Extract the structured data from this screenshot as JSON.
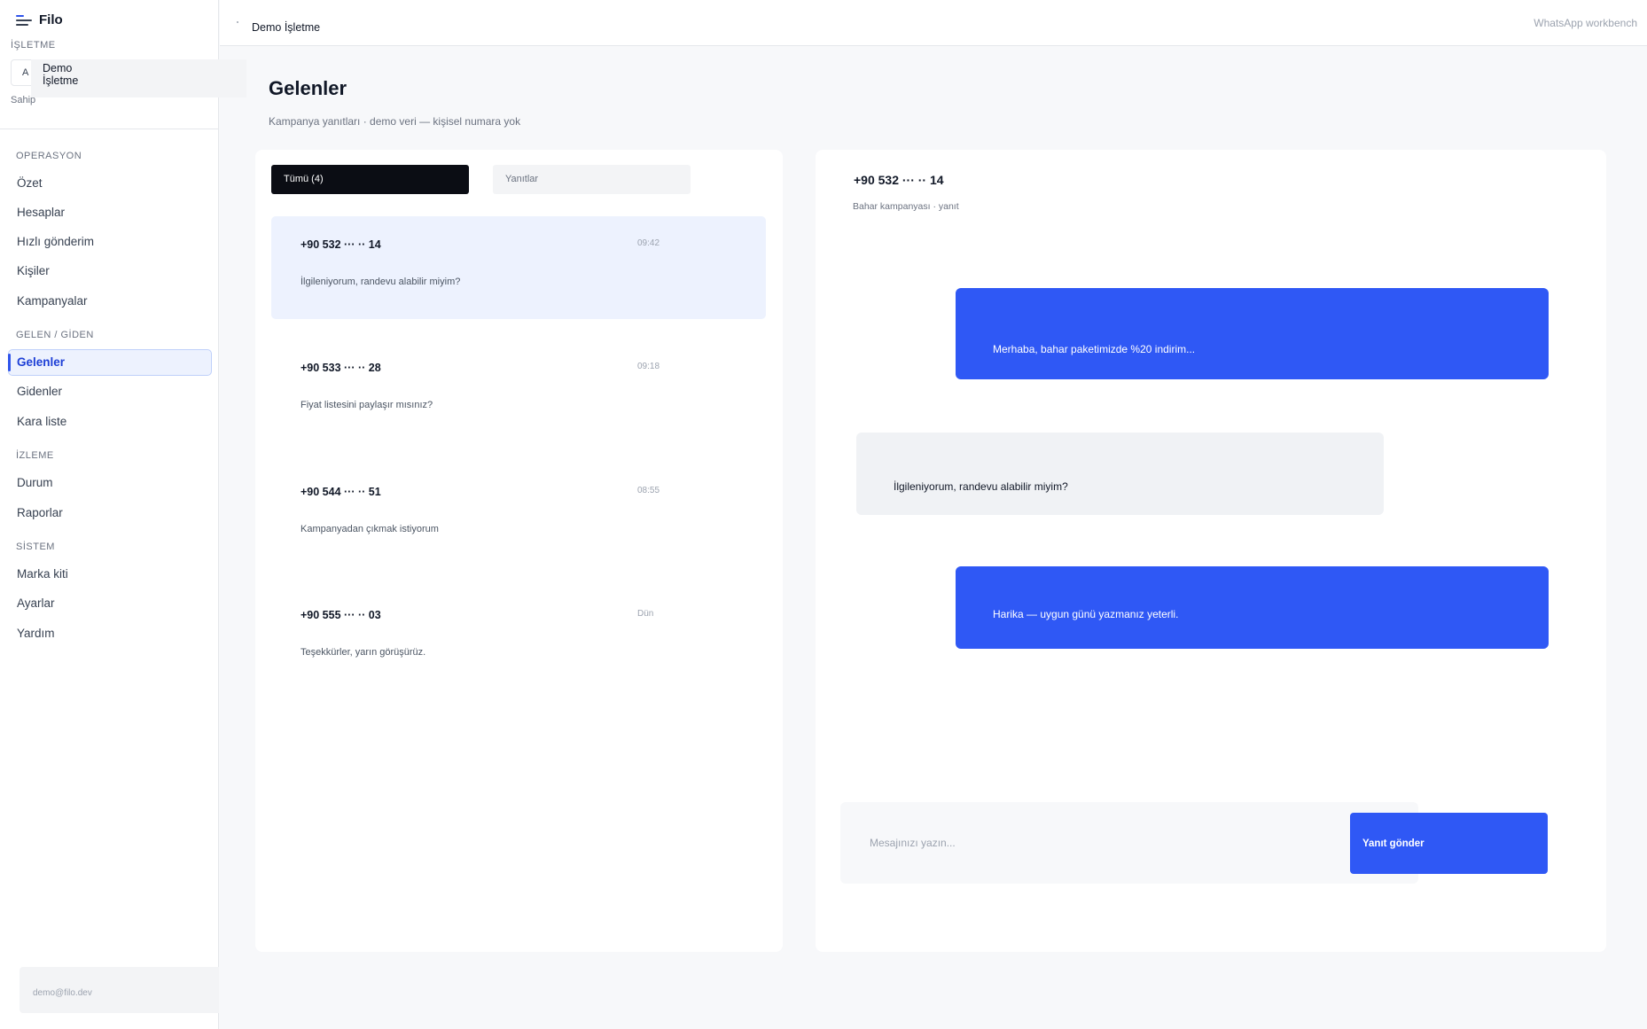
{
  "app": {
    "name": "Filo"
  },
  "sidebar": {
    "workspace_caption": "İŞLETME",
    "workspace_avatar": "A",
    "workspace_name": "Demo İşletme",
    "workspace_role": "Sahip",
    "sections": [
      {
        "title": "OPERASYON",
        "items": [
          "Özet",
          "Hesaplar",
          "Hızlı gönderim",
          "Kişiler",
          "Kampanyalar"
        ]
      },
      {
        "title": "GELEN / GİDEN",
        "items": [
          "Gelenler",
          "Gidenler",
          "Kara liste"
        ]
      },
      {
        "title": "İZLEME",
        "items": [
          "Durum",
          "Raporlar"
        ]
      },
      {
        "title": "SİSTEM",
        "items": [
          "Marka kiti",
          "Ayarlar",
          "Yardım"
        ]
      }
    ],
    "active_item": "Gelenler",
    "footer_email": "demo@filo.dev"
  },
  "topbar": {
    "breadcrumb": "Demo İşletme",
    "right_label": "WhatsApp workbench"
  },
  "page": {
    "title": "Gelenler",
    "subtitle": "Kampanya yanıtları · demo veri — kişisel numara yok"
  },
  "inbox": {
    "tabs": [
      {
        "label": "Tümü (4)",
        "active": true
      },
      {
        "label": "Yanıtlar",
        "active": false
      }
    ],
    "messages": [
      {
        "phone": "+90 532 ··· ·· 14",
        "time": "09:42",
        "text": "İlgileniyorum, randevu alabilir miyim?",
        "selected": true
      },
      {
        "phone": "+90 533 ··· ·· 28",
        "time": "09:18",
        "text": "Fiyat listesini paylaşır mısınız?",
        "selected": false
      },
      {
        "phone": "+90 544 ··· ·· 51",
        "time": "08:55",
        "text": "Kampanyadan çıkmak istiyorum",
        "selected": false
      },
      {
        "phone": "+90 555 ··· ·· 03",
        "time": "Dün",
        "text": "Teşekkürler, yarın görüşürüz.",
        "selected": false
      }
    ]
  },
  "conversation": {
    "phone": "+90 532 ··· ·· 14",
    "subtitle": "Bahar kampanyası · yanıt",
    "bubbles": [
      {
        "direction": "outgoing",
        "text": "Merhaba, bahar paketimizde %20 indirim..."
      },
      {
        "direction": "incoming",
        "text": "İlgileniyorum, randevu alabilir miyim?"
      },
      {
        "direction": "outgoing",
        "text": "Harika — uygun günü yazmanız yeterli."
      }
    ],
    "composer_placeholder": "Mesajınızı yazın...",
    "send_label": "Yanıt gönder"
  },
  "colors": {
    "accent": "#2f58f5",
    "active_nav_bg": "#edf2fe",
    "tab_active_bg": "#0b0d14",
    "incoming_bubble": "#f0f2f5"
  }
}
